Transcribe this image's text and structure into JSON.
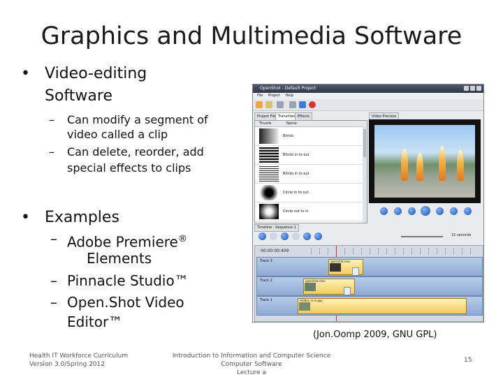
{
  "slide": {
    "title": "Graphics and Multimedia Software",
    "bullet1": "Video-editing",
    "bullet1_cont": "Software",
    "sub1_line1": "Can modify a segment of",
    "sub1_line2": "video called a clip",
    "sub2_line1": "Can delete, reorder, add",
    "sub2_line2": "special effects to clips",
    "bullet2": "Examples",
    "ex1_line1": "Adobe Premiere",
    "ex1_reg": "®",
    "ex1_line2": "Elements",
    "ex2": "Pinnacle Studio™",
    "ex3_line1": "Open.Shot Video",
    "ex3_line2": "Editor™",
    "bullet_symbol": "•",
    "dash_symbol": "–",
    "caption": "(Jon.Oomp 2009, GNU GPL)",
    "footer_left_line1": "Health IT Workforce Curriculum",
    "footer_left_line2": "Version 3.0/Spring 2012",
    "footer_center_line1": "Introduction to Information and Computer Science",
    "footer_center_line2": "Computer Software",
    "footer_center_line3": "Lecture a",
    "page_number": "15"
  },
  "screenshot": {
    "window_title": "OpenShot - Default Project",
    "menu": [
      "File",
      "Project",
      "Help"
    ],
    "tabs": [
      "Project Files",
      "Transitions",
      "Effects"
    ],
    "list_headers": [
      "Thumb",
      "Name"
    ],
    "transitions": [
      "Blinds",
      "Blinds in to out",
      "Blinds in to out",
      "Circle in to out",
      "Circle out to in"
    ],
    "preview_tab": "Video Preview",
    "timeline_tab": "Timeline - Sequence 1",
    "timecode": "00:00:00:409",
    "zoom_label": "15 seconds",
    "tracks": [
      "Track 3",
      "Track 2",
      "Track 1"
    ],
    "clips": [
      "openshot.mov",
      "openshot.mov",
      "Hidden in.m.jpg"
    ]
  }
}
